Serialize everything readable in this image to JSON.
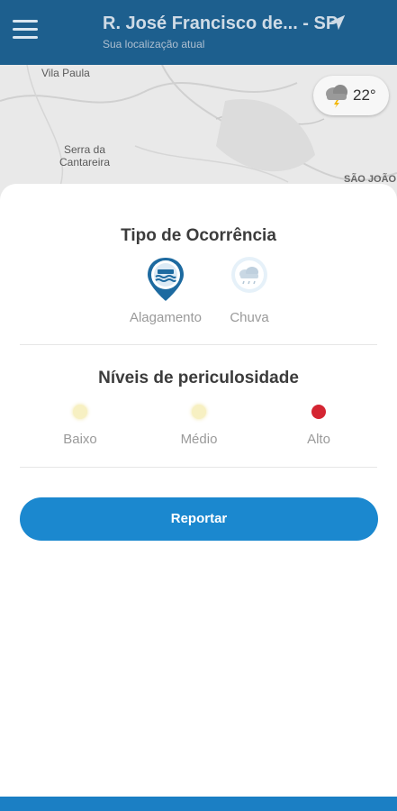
{
  "header": {
    "title": "R. José Francisco de... - SP",
    "subtitle": "Sua localização atual"
  },
  "map": {
    "labels": [
      "Vila Paula",
      "Serra da\nCantareira",
      "SÃO JOÃO"
    ],
    "weather": {
      "temperature": "22°",
      "icon": "storm-cloud-icon"
    }
  },
  "occurrence": {
    "title": "Tipo de Ocorrência",
    "types": [
      {
        "label": "Alagamento",
        "icon": "flood-icon",
        "selected": true
      },
      {
        "label": "Chuva",
        "icon": "rain-icon",
        "selected": false
      }
    ]
  },
  "danger": {
    "title": "Níveis de periculosidade",
    "levels": [
      {
        "label": "Baixo",
        "color": "#f7f0c2",
        "selected": false
      },
      {
        "label": "Médio",
        "color": "#f7f0c2",
        "selected": false
      },
      {
        "label": "Alto",
        "color": "#d42532",
        "selected": true
      }
    ]
  },
  "actions": {
    "report_label": "Reportar"
  },
  "colors": {
    "header": "#1d5f8e",
    "primary": "#1b88cf",
    "accent_danger": "#d42532"
  }
}
